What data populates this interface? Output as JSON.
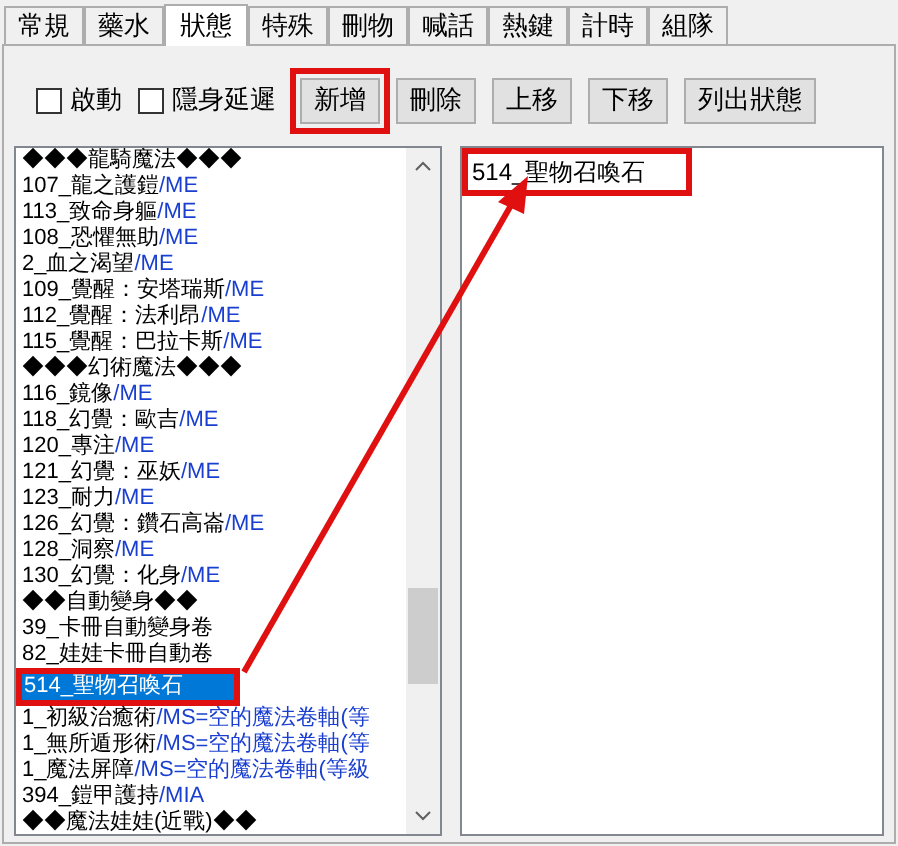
{
  "tabs": [
    {
      "label": "常規",
      "selected": false
    },
    {
      "label": "藥水",
      "selected": false
    },
    {
      "label": "狀態",
      "selected": true
    },
    {
      "label": "特殊",
      "selected": false
    },
    {
      "label": "刪物",
      "selected": false
    },
    {
      "label": "喊話",
      "selected": false
    },
    {
      "label": "熱鍵",
      "selected": false
    },
    {
      "label": "計時",
      "selected": false
    },
    {
      "label": "組隊",
      "selected": false
    }
  ],
  "checkboxes": [
    {
      "label": "啟動",
      "checked": false
    },
    {
      "label": "隱身延遲",
      "checked": false
    }
  ],
  "buttons": [
    {
      "label": "新增",
      "highlighted": true
    },
    {
      "label": "刪除",
      "highlighted": false
    },
    {
      "label": "上移",
      "highlighted": false
    },
    {
      "label": "下移",
      "highlighted": false
    },
    {
      "label": "列出狀態",
      "highlighted": false
    }
  ],
  "status_list": {
    "items": [
      {
        "name": "◆◆◆龍騎魔法◆◆◆",
        "selected": false,
        "highlighted": false
      },
      {
        "name": "107_龍之護鎧",
        "suffix": "/ME",
        "selected": false,
        "highlighted": false
      },
      {
        "name": "113_致命身軀",
        "suffix": "/ME",
        "selected": false,
        "highlighted": false
      },
      {
        "name": "108_恐懼無助",
        "suffix": "/ME",
        "selected": false,
        "highlighted": false
      },
      {
        "name": "2_血之渴望",
        "suffix": "/ME",
        "selected": false,
        "highlighted": false
      },
      {
        "name": "109_覺醒：安塔瑞斯",
        "suffix": "/ME",
        "selected": false,
        "highlighted": false
      },
      {
        "name": "112_覺醒：法利昂",
        "suffix": "/ME",
        "selected": false,
        "highlighted": false
      },
      {
        "name": "115_覺醒：巴拉卡斯",
        "suffix": "/ME",
        "selected": false,
        "highlighted": false
      },
      {
        "name": "◆◆◆幻術魔法◆◆◆",
        "selected": false,
        "highlighted": false
      },
      {
        "name": "116_鏡像",
        "suffix": "/ME",
        "selected": false,
        "highlighted": false
      },
      {
        "name": "118_幻覺：歐吉",
        "suffix": "/ME",
        "selected": false,
        "highlighted": false
      },
      {
        "name": "120_專注",
        "suffix": "/ME",
        "selected": false,
        "highlighted": false
      },
      {
        "name": "121_幻覺：巫妖",
        "suffix": "/ME",
        "selected": false,
        "highlighted": false
      },
      {
        "name": "123_耐力",
        "suffix": "/ME",
        "selected": false,
        "highlighted": false
      },
      {
        "name": "126_幻覺：鑽石高崙",
        "suffix": "/ME",
        "selected": false,
        "highlighted": false
      },
      {
        "name": "128_洞察",
        "suffix": "/ME",
        "selected": false,
        "highlighted": false
      },
      {
        "name": "130_幻覺：化身",
        "suffix": "/ME",
        "selected": false,
        "highlighted": false
      },
      {
        "name": "◆◆自動變身◆◆",
        "selected": false,
        "highlighted": false
      },
      {
        "name": "39_卡冊自動變身卷",
        "selected": false,
        "highlighted": false
      },
      {
        "name": "82_娃娃卡冊自動卷",
        "selected": false,
        "highlighted": false
      },
      {
        "name": "514_聖物召喚石",
        "selected": true,
        "highlighted": true
      },
      {
        "name": "1_初級治癒術",
        "suffix": "/MS=空的魔法卷軸(等",
        "selected": false,
        "highlighted": false
      },
      {
        "name": "1_無所遁形術",
        "suffix": "/MS=空的魔法卷軸(等",
        "selected": false,
        "highlighted": false
      },
      {
        "name": "1_魔法屏障",
        "suffix": "/MS=空的魔法卷軸(等級",
        "selected": false,
        "highlighted": false
      },
      {
        "name": "394_鎧甲護持",
        "suffix": "/MIA",
        "selected": false,
        "highlighted": false
      },
      {
        "name": "◆◆魔法娃娃(近戰)◆◆",
        "selected": false,
        "highlighted": false
      }
    ]
  },
  "active_list": {
    "items": [
      {
        "name": "514_聖物召喚石",
        "highlighted": true
      }
    ]
  }
}
